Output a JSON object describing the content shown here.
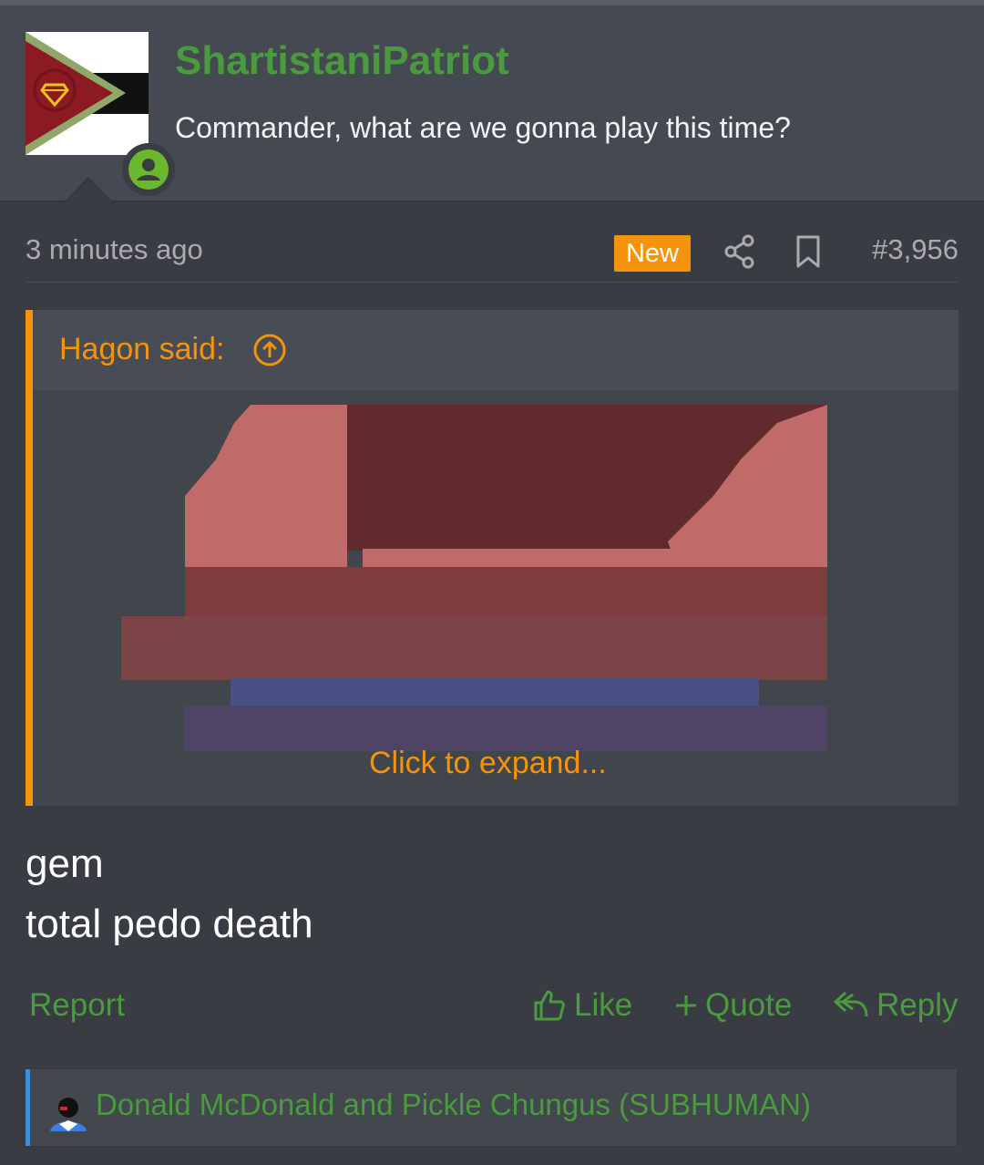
{
  "post": {
    "username": "ShartistaniPatriot",
    "user_title": "Commander, what are we gonna play this time?",
    "time": "3 minutes ago",
    "new_badge": "New",
    "post_number": "#3,956"
  },
  "quote": {
    "author": "Hagon said:",
    "expand": "Click to expand..."
  },
  "body": {
    "line1": "gem",
    "line2": "total pedo death"
  },
  "actions": {
    "report": "Report",
    "like": "Like",
    "quote": "Quote",
    "reply": "Reply"
  },
  "reactions": {
    "text": "Donald McDonald and Pickle Chungus (SUBHUMAN)"
  },
  "colors": {
    "accent_orange": "#f5940c",
    "green": "#4a9a3e",
    "background": "#393c43",
    "reaction_bar": "#3c8fd8"
  },
  "icons": {
    "avatar_badge": "user-circle-icon",
    "share": "share-icon",
    "bookmark": "bookmark-icon",
    "quote_jump": "arrow-up-circle-icon",
    "like": "thumbs-up-icon",
    "quote_plus": "plus-icon",
    "reply": "reply-icon"
  }
}
